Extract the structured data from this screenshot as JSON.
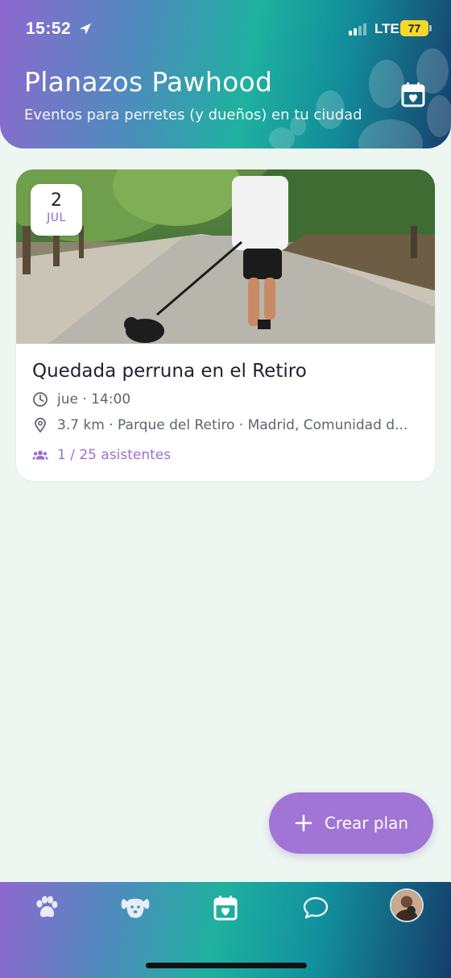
{
  "status_bar": {
    "time": "15:52",
    "network": "LTE",
    "battery": "77"
  },
  "header": {
    "title": "Planazos Pawhood",
    "subtitle": "Eventos para perretes (y dueños) en tu ciudad",
    "calendar_icon": "calendar-heart-icon"
  },
  "events": [
    {
      "date_day": "2",
      "date_month": "JUL",
      "title": "Quedada perruna en el Retiro",
      "time": "jue · 14:00",
      "location": "3.7 km · Parque del Retiro · Madrid, Comunidad d...",
      "attendees": "1 / 25 asistentes"
    }
  ],
  "fab": {
    "label": "Crear plan"
  },
  "bottom_nav": {
    "items": [
      "paw-icon",
      "dog-icon",
      "calendar-heart-icon",
      "chat-icon",
      "avatar"
    ]
  },
  "colors": {
    "accent": "#a075d6",
    "background": "#edf6f1",
    "teal": "#1eb19f"
  }
}
